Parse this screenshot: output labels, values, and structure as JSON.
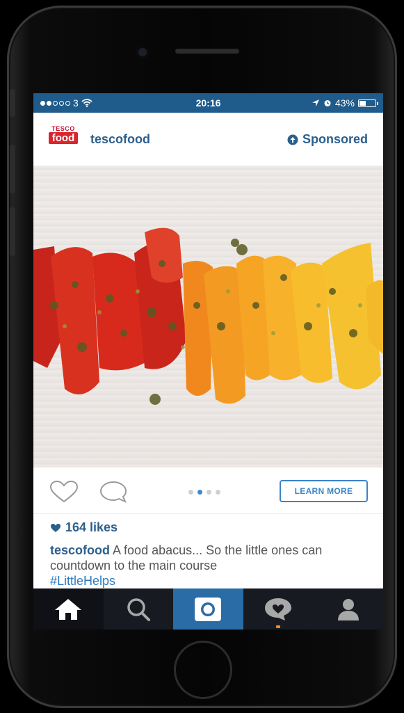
{
  "status_bar": {
    "carrier": "3",
    "time": "20:16",
    "battery_percent": "43%",
    "battery_level": 0.43,
    "signal_dots_filled": 2
  },
  "post": {
    "brand_logo": {
      "top": "TESCO",
      "bottom": "food"
    },
    "username": "tescofood",
    "sponsored_label": "Sponsored",
    "likes": "164 likes",
    "caption_user": "tescofood",
    "caption_text": "A food abacus... So the little ones can countdown to the main course",
    "caption_tag": "#LittleHelps",
    "learn_more_label": "LEARN MORE",
    "carousel_pages": 4,
    "carousel_active": 1,
    "colors": {
      "link": "#2d5f8c",
      "accent": "#3a84c8",
      "status_bar": "#1f5b8b"
    }
  },
  "tab_bar": {
    "items": [
      {
        "icon": "home-icon"
      },
      {
        "icon": "search-icon"
      },
      {
        "icon": "camera-icon"
      },
      {
        "icon": "activity-icon"
      },
      {
        "icon": "profile-icon"
      }
    ]
  }
}
